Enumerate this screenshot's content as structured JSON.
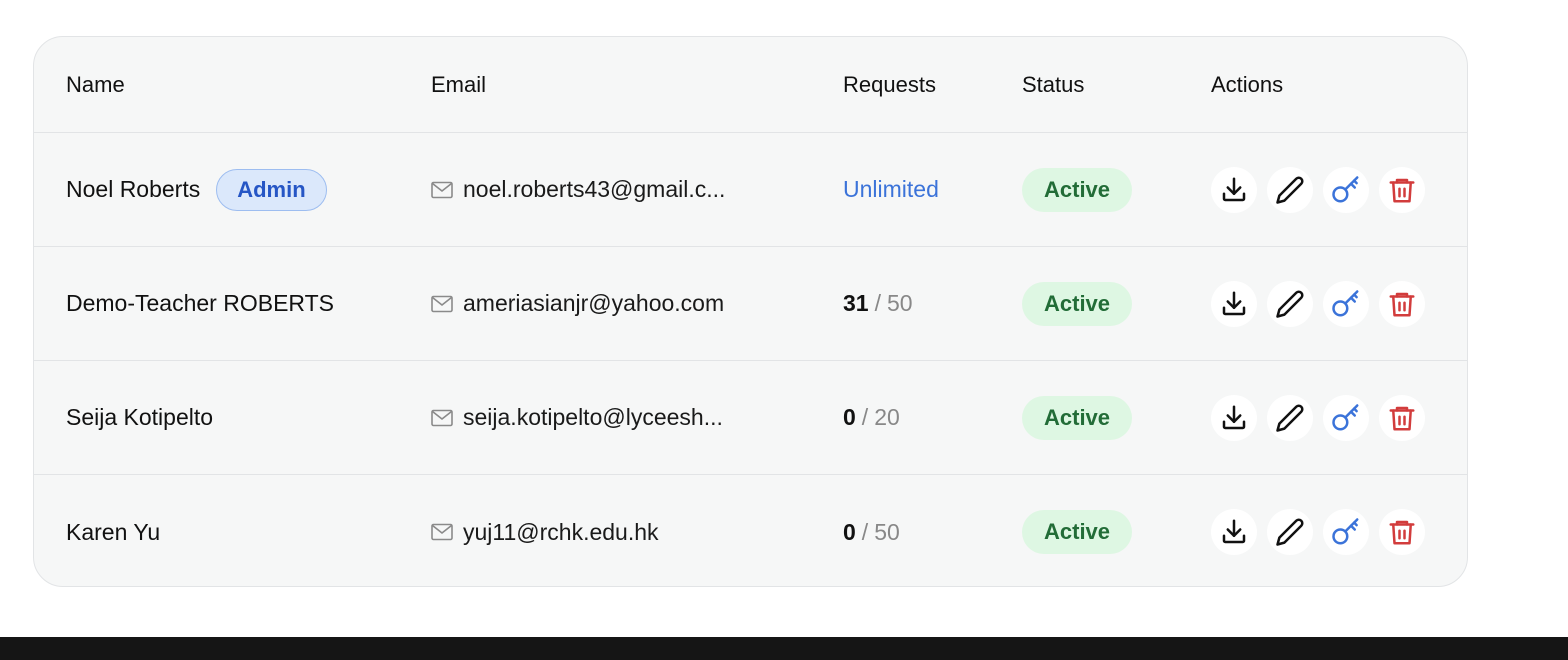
{
  "table": {
    "headers": {
      "name": "Name",
      "email": "Email",
      "requests": "Requests",
      "status": "Status",
      "actions": "Actions"
    },
    "rows": [
      {
        "name": "Noel Roberts",
        "badge": "Admin",
        "email": "noel.roberts43@gmail.c...",
        "requests_text": "Unlimited",
        "status": "Active"
      },
      {
        "name": "Demo-Teacher ROBERTS",
        "email": "ameriasianjr@yahoo.com",
        "requests_used": "31",
        "requests_sep": "/",
        "requests_total": "50",
        "status": "Active"
      },
      {
        "name": "Seija Kotipelto",
        "email": "seija.kotipelto@lyceesh...",
        "requests_used": "0",
        "requests_sep": "/",
        "requests_total": "20",
        "status": "Active"
      },
      {
        "name": "Karen Yu",
        "email": "yuj11@rchk.edu.hk",
        "requests_used": "0",
        "requests_sep": "/",
        "requests_total": "50",
        "status": "Active"
      }
    ],
    "action_icons": [
      "download-icon",
      "pencil-icon",
      "key-icon",
      "trash-icon"
    ]
  },
  "colors": {
    "link_blue": "#3b73d9",
    "status_green_bg": "#def7e3",
    "status_green_text": "#226c37",
    "delete_red": "#d23c3c",
    "admin_badge_bg": "#dbe8fb"
  }
}
